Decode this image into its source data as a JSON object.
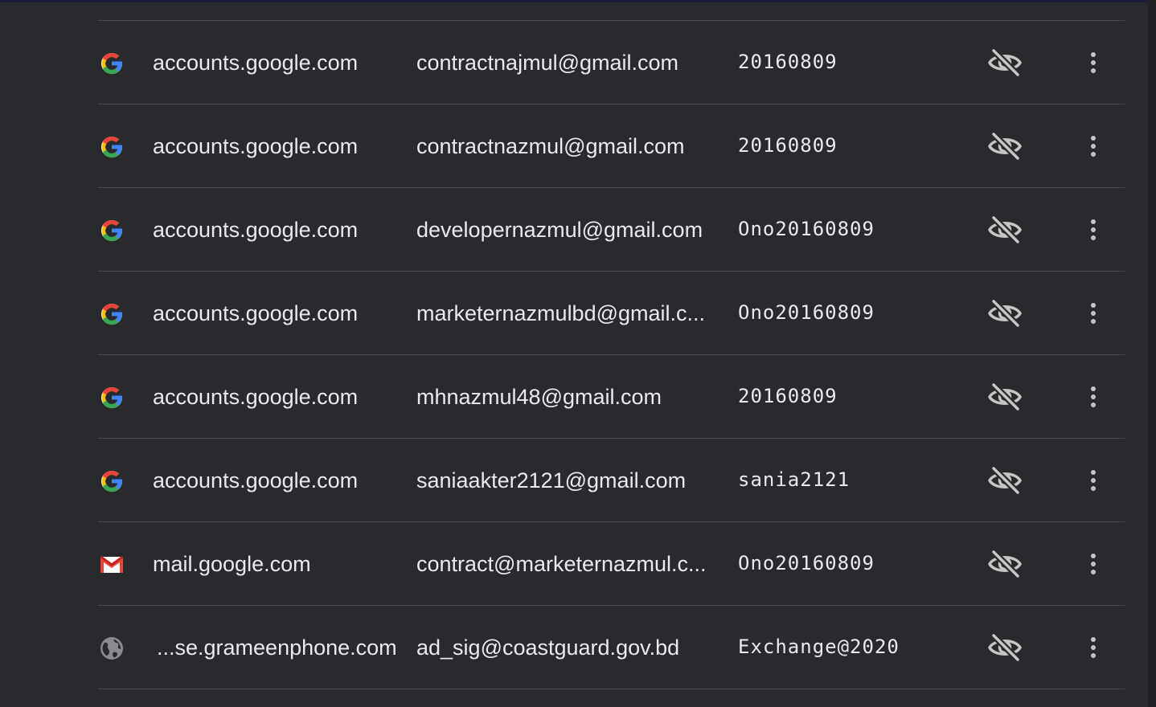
{
  "colors": {
    "background": "#292a2d",
    "text": "#e8eaed",
    "divider": "#4a4b4f",
    "icon": "#c4c7c5"
  },
  "rows": [
    {
      "favicon": "google-icon",
      "site": "accounts.google.com",
      "username": "contractnajmul@gmail.com",
      "password": "20160809"
    },
    {
      "favicon": "google-icon",
      "site": "accounts.google.com",
      "username": "contractnazmul@gmail.com",
      "password": "20160809"
    },
    {
      "favicon": "google-icon",
      "site": "accounts.google.com",
      "username": "developernazmul@gmail.com",
      "password": "Ono20160809"
    },
    {
      "favicon": "google-icon",
      "site": "accounts.google.com",
      "username": "marketernazmulbd@gmail.c...",
      "password": "Ono20160809"
    },
    {
      "favicon": "google-icon",
      "site": "accounts.google.com",
      "username": "mhnazmul48@gmail.com",
      "password": "20160809"
    },
    {
      "favicon": "google-icon",
      "site": "accounts.google.com",
      "username": "saniaakter2121@gmail.com",
      "password": "sania2121"
    },
    {
      "favicon": "gmail-icon",
      "site": "mail.google.com",
      "username": "contract@marketernazmul.c...",
      "password": "Ono20160809"
    },
    {
      "favicon": "globe-icon",
      "site": "...se.grameenphone.com",
      "username": "ad_sig@coastguard.gov.bd",
      "password": "Exchange@2020"
    }
  ]
}
